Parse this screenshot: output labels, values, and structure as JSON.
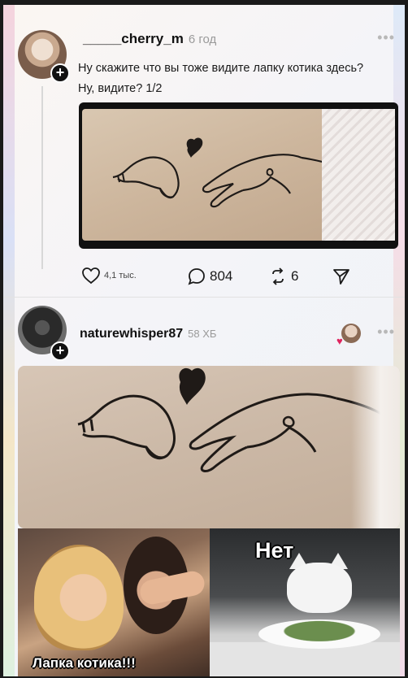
{
  "post1": {
    "username": "_____cherry_m",
    "time": "6 год",
    "text": "Ну скажите что вы тоже видите лапку котика здесь? Ну, видите? 1/2",
    "actions": {
      "likes": "4,1 тыс.",
      "comments": "804",
      "reposts": "6"
    }
  },
  "post2": {
    "username": "naturewhisper87",
    "time": "58 ХБ"
  },
  "meme": {
    "caption_left": "Лапка котика!!!",
    "caption_right": "Нет"
  },
  "icons": {
    "heart": "heart-icon",
    "comment": "comment-icon",
    "repost": "repost-icon",
    "share": "send-icon",
    "more": "more-icon",
    "follow": "plus-icon"
  },
  "colors": {
    "accent_heart": "#e0245e",
    "text": "#111111",
    "muted": "#9a9a9a"
  }
}
